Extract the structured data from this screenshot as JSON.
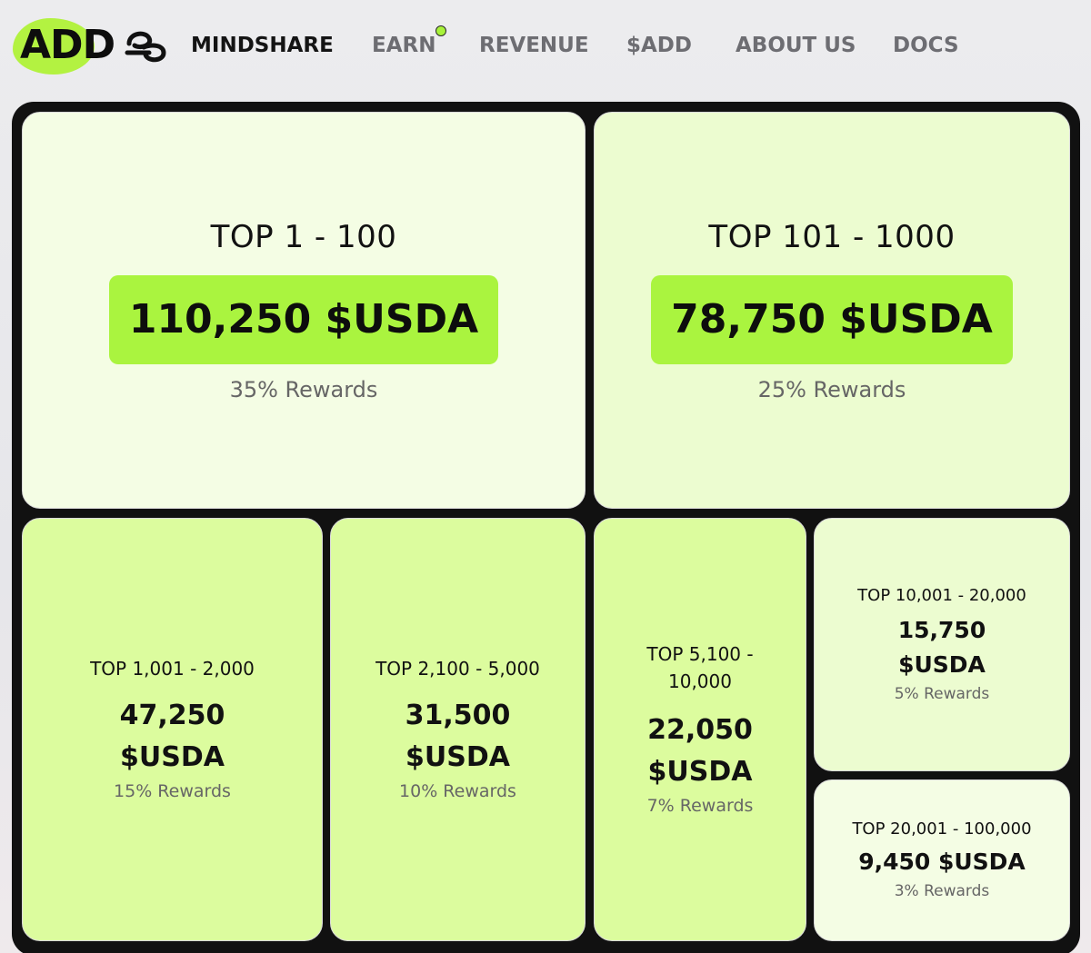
{
  "header": {
    "logo_text": "ADD",
    "nav": [
      {
        "label": "MINDSHARE"
      },
      {
        "label": "EARN"
      },
      {
        "label": "REVENUE"
      },
      {
        "label": "$ADD"
      },
      {
        "label": "ABOUT US"
      },
      {
        "label": "DOCS"
      }
    ]
  },
  "tiers": [
    {
      "range": "TOP 1 - 100",
      "amount": "110,250 $USDA",
      "reward": "35% Rewards"
    },
    {
      "range": "TOP 101 - 1000",
      "amount": "78,750 $USDA",
      "reward": "25% Rewards"
    },
    {
      "range": "TOP 1,001 - 2,000",
      "amount_line1": "47,250",
      "amount_line2": "$USDA",
      "reward": "15% Rewards"
    },
    {
      "range": "TOP 2,100 - 5,000",
      "amount_line1": "31,500",
      "amount_line2": "$USDA",
      "reward": "10% Rewards"
    },
    {
      "range_line1": "TOP 5,100 -",
      "range_line2": "10,000",
      "amount_line1": "22,050",
      "amount_line2": "$USDA",
      "reward": "7% Rewards"
    },
    {
      "range": "TOP 10,001 - 20,000",
      "amount_line1": "15,750",
      "amount_line2": "$USDA",
      "reward": "5% Rewards"
    },
    {
      "range": "TOP 20,001 - 100,000",
      "amount": "9,450 $USDA",
      "reward": "3% Rewards"
    }
  ]
}
